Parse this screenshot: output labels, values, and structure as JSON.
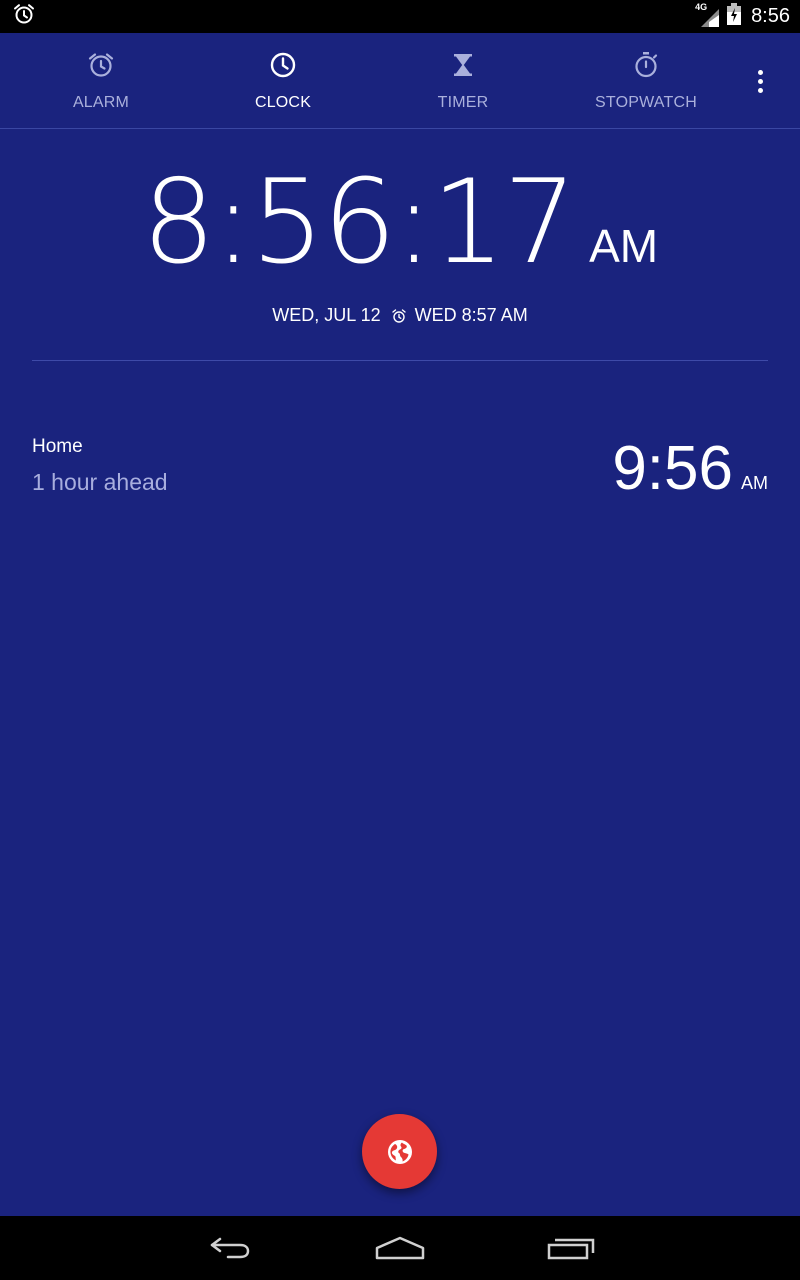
{
  "status_bar": {
    "time": "8:56",
    "network_label": "4G",
    "icons": [
      "alarm-icon",
      "signal-icon",
      "battery-icon"
    ]
  },
  "tabs": [
    {
      "label": "ALARM",
      "icon": "alarm-icon",
      "active": false
    },
    {
      "label": "CLOCK",
      "icon": "clock-icon",
      "active": true
    },
    {
      "label": "TIMER",
      "icon": "hourglass-icon",
      "active": false
    },
    {
      "label": "STOPWATCH",
      "icon": "stopwatch-icon",
      "active": false
    }
  ],
  "overflow_menu": {
    "icon": "more-vert-icon"
  },
  "main_clock": {
    "time": "8:56:17",
    "ampm": "AM",
    "date": "WED, JUL 12",
    "next_alarm": "WED 8:57 AM"
  },
  "cities": [
    {
      "name": "Home",
      "offset": "1 hour ahead",
      "time": "9:56",
      "ampm": "AM"
    }
  ],
  "fab": {
    "icon": "globe-icon"
  },
  "nav_bar": {
    "icons": [
      "back-icon",
      "home-icon",
      "recents-icon"
    ]
  },
  "colors": {
    "background": "#1a237e",
    "fab": "#e53935",
    "inactive_tab": "#aab0dc",
    "secondary_text": "#a8aede"
  }
}
